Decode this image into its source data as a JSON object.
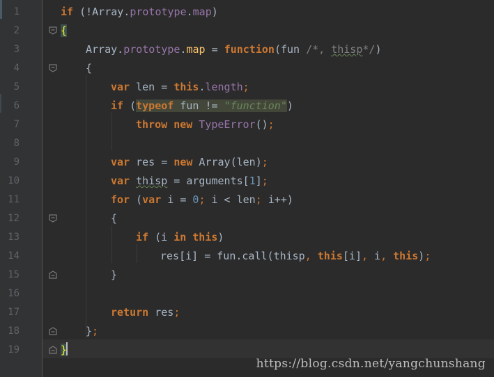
{
  "editor": {
    "lines": [
      {
        "n": "1",
        "text": "if (!Array.prototype.map)"
      },
      {
        "n": "2",
        "text": "{"
      },
      {
        "n": "3",
        "text": "    Array.prototype.map = function(fun /*, thisp*/)"
      },
      {
        "n": "4",
        "text": "    {"
      },
      {
        "n": "5",
        "text": "        var len = this.length;"
      },
      {
        "n": "6",
        "text": "        if (typeof fun != \"function\")"
      },
      {
        "n": "7",
        "text": "            throw new TypeError();"
      },
      {
        "n": "8",
        "text": ""
      },
      {
        "n": "9",
        "text": "        var res = new Array(len);"
      },
      {
        "n": "10",
        "text": "        var thisp = arguments[1];"
      },
      {
        "n": "11",
        "text": "        for (var i = 0; i < len; i++)"
      },
      {
        "n": "12",
        "text": "        {"
      },
      {
        "n": "13",
        "text": "            if (i in this)"
      },
      {
        "n": "14",
        "text": "                res[i] = fun.call(thisp, this[i], i, this);"
      },
      {
        "n": "15",
        "text": "        }"
      },
      {
        "n": "16",
        "text": ""
      },
      {
        "n": "17",
        "text": "        return res;"
      },
      {
        "n": "18",
        "text": "    };"
      },
      {
        "n": "19",
        "text": "}"
      }
    ],
    "tokens": {
      "l1_if": "if",
      "l1_rest_a": " (!",
      "l1_array": "Array",
      "l1_dot1": ".",
      "l1_prototype": "prototype",
      "l1_dot2": ".",
      "l1_map": "map",
      "l1_close": ")",
      "l2_brace": "{",
      "l3_array": "Array",
      "l3_dot1": ".",
      "l3_prototype": "prototype",
      "l3_dot2": ".",
      "l3_map": "map",
      "l3_eq": " = ",
      "l3_function": "function",
      "l3_open": "(fun ",
      "l3_comment_a": "/*, ",
      "l3_comment_thisp": "thisp",
      "l3_comment_b": "*/",
      "l3_close": ")",
      "l4_brace": "{",
      "l5_var": "var",
      "l5_len": " len = ",
      "l5_this": "this",
      "l5_dot": ".",
      "l5_length": "length",
      "l5_semi": ";",
      "l6_if": "if",
      "l6_open": " (",
      "l6_typeof": "typeof",
      "l6_mid": " fun != ",
      "l6_str": "\"function\"",
      "l6_close": ")",
      "l7_throw": "throw",
      "l7_sp": " ",
      "l7_new": "new",
      "l7_type": " TypeError",
      "l7_paren": "()",
      "l7_semi": ";",
      "l9_var": "var",
      "l9_res": " res = ",
      "l9_new": "new",
      "l9_array": " Array(len)",
      "l9_semi": ";",
      "l10_var": "var",
      "l10_sp": " ",
      "l10_thisp": "thisp",
      "l10_eq": " = arguments[",
      "l10_one": "1",
      "l10_close": "]",
      "l10_semi": ";",
      "l11_for": "for",
      "l11_open": " (",
      "l11_var": "var",
      "l11_i": " i = ",
      "l11_zero": "0",
      "l11_semi1": ";",
      "l11_cond": " i < len",
      "l11_semi2": ";",
      "l11_inc": " i++)",
      "l12_brace": "{",
      "l13_if": "if",
      "l13_open": " (i ",
      "l13_in": "in",
      "l13_sp": " ",
      "l13_this": "this",
      "l13_close": ")",
      "l14_res": "res[i] = fun.",
      "l14_call": "call",
      "l14_open": "(thisp",
      "l14_c1": ",",
      "l14_sp1": " ",
      "l14_this1": "this",
      "l14_idx": "[i]",
      "l14_c2": ",",
      "l14_i": " i",
      "l14_c3": ",",
      "l14_sp2": " ",
      "l14_this2": "this",
      "l14_close": ")",
      "l14_semi": ";",
      "l15_brace": "}",
      "l17_return": "return",
      "l17_res": " res",
      "l17_semi": ";",
      "l18_brace": "}",
      "l18_semi": ";",
      "l19_brace": "}"
    }
  },
  "watermark": "https://blog.csdn.net/yangchunshang",
  "colors": {
    "background": "#2b2b2b",
    "gutter": "#313335",
    "keyword": "#cc7832",
    "property": "#9876aa",
    "string": "#6a8759",
    "number": "#6897bb",
    "comment": "#808080",
    "text": "#a9b7c6",
    "line_number": "#606366",
    "brace_match": "#ffef28"
  }
}
